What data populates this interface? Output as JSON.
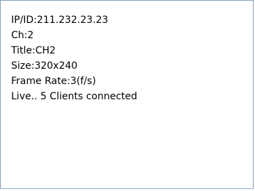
{
  "info": {
    "lines": [
      "IP/ID:211.232.23.23",
      "Ch:2",
      "Title:CH2",
      "Size:320x240",
      "Frame Rate:3(f/s)",
      "Live.. 5 Clients connected"
    ]
  },
  "colors": {
    "border": "#7f9db9",
    "background": "#ffffff",
    "text": "#000000"
  }
}
